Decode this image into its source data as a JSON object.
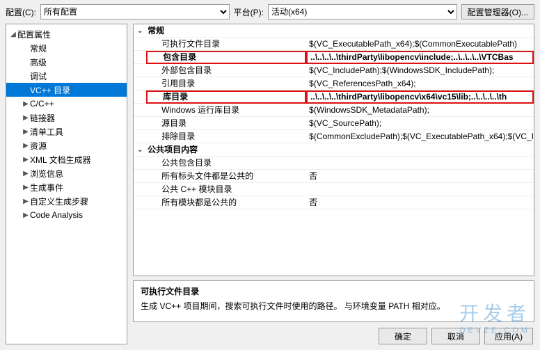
{
  "topbar": {
    "config_label": "配置(C):",
    "config_value": "所有配置",
    "platform_label": "平台(P):",
    "platform_value": "活动(x64)",
    "manager_button": "配置管理器(O)..."
  },
  "tree": {
    "root": "配置属性",
    "items": [
      {
        "label": "常规",
        "chev": ""
      },
      {
        "label": "高级",
        "chev": ""
      },
      {
        "label": "调试",
        "chev": ""
      },
      {
        "label": "VC++ 目录",
        "chev": "",
        "selected": true
      },
      {
        "label": "C/C++",
        "chev": "▶"
      },
      {
        "label": "链接器",
        "chev": "▶"
      },
      {
        "label": "清单工具",
        "chev": "▶"
      },
      {
        "label": "资源",
        "chev": "▶"
      },
      {
        "label": "XML 文档生成器",
        "chev": "▶"
      },
      {
        "label": "浏览信息",
        "chev": "▶"
      },
      {
        "label": "生成事件",
        "chev": "▶"
      },
      {
        "label": "自定义生成步骤",
        "chev": "▶"
      },
      {
        "label": "Code Analysis",
        "chev": "▶"
      }
    ]
  },
  "props": {
    "categories": [
      {
        "name": "常规",
        "rows": [
          {
            "name": "可执行文件目录",
            "value": "$(VC_ExecutablePath_x64);$(CommonExecutablePath)"
          },
          {
            "name": "包含目录",
            "value": "..\\..\\..\\..\\thirdParty\\libopencv\\include;..\\..\\..\\..\\VTCBas",
            "highlight": true
          },
          {
            "name": "外部包含目录",
            "value": "$(VC_IncludePath);$(WindowsSDK_IncludePath);"
          },
          {
            "name": "引用目录",
            "value": "$(VC_ReferencesPath_x64);"
          },
          {
            "name": "库目录",
            "value": "..\\..\\..\\..\\thirdParty\\libopencv\\x64\\vc15\\lib;..\\..\\..\\..\\th",
            "highlight": true
          },
          {
            "name": "Windows 运行库目录",
            "value": "$(WindowsSDK_MetadataPath);"
          },
          {
            "name": "源目录",
            "value": "$(VC_SourcePath);"
          },
          {
            "name": "排除目录",
            "value": "$(CommonExcludePath);$(VC_ExecutablePath_x64);$(VC_I"
          }
        ]
      },
      {
        "name": "公共项目内容",
        "rows": [
          {
            "name": "公共包含目录",
            "value": ""
          },
          {
            "name": "所有标头文件都是公共的",
            "value": "否"
          },
          {
            "name": "公共 C++ 模块目录",
            "value": ""
          },
          {
            "name": "所有模块都是公共的",
            "value": "否"
          }
        ]
      }
    ]
  },
  "description": {
    "title": "可执行文件目录",
    "text": "生成 VC++ 项目期间，搜索可执行文件时使用的路径。 与环境变量 PATH 相对应。"
  },
  "buttons": {
    "ok": "确定",
    "cancel": "取消",
    "apply": "应用(A)"
  },
  "watermark": {
    "main": "开发者",
    "sub": "DEVZE.COM"
  }
}
